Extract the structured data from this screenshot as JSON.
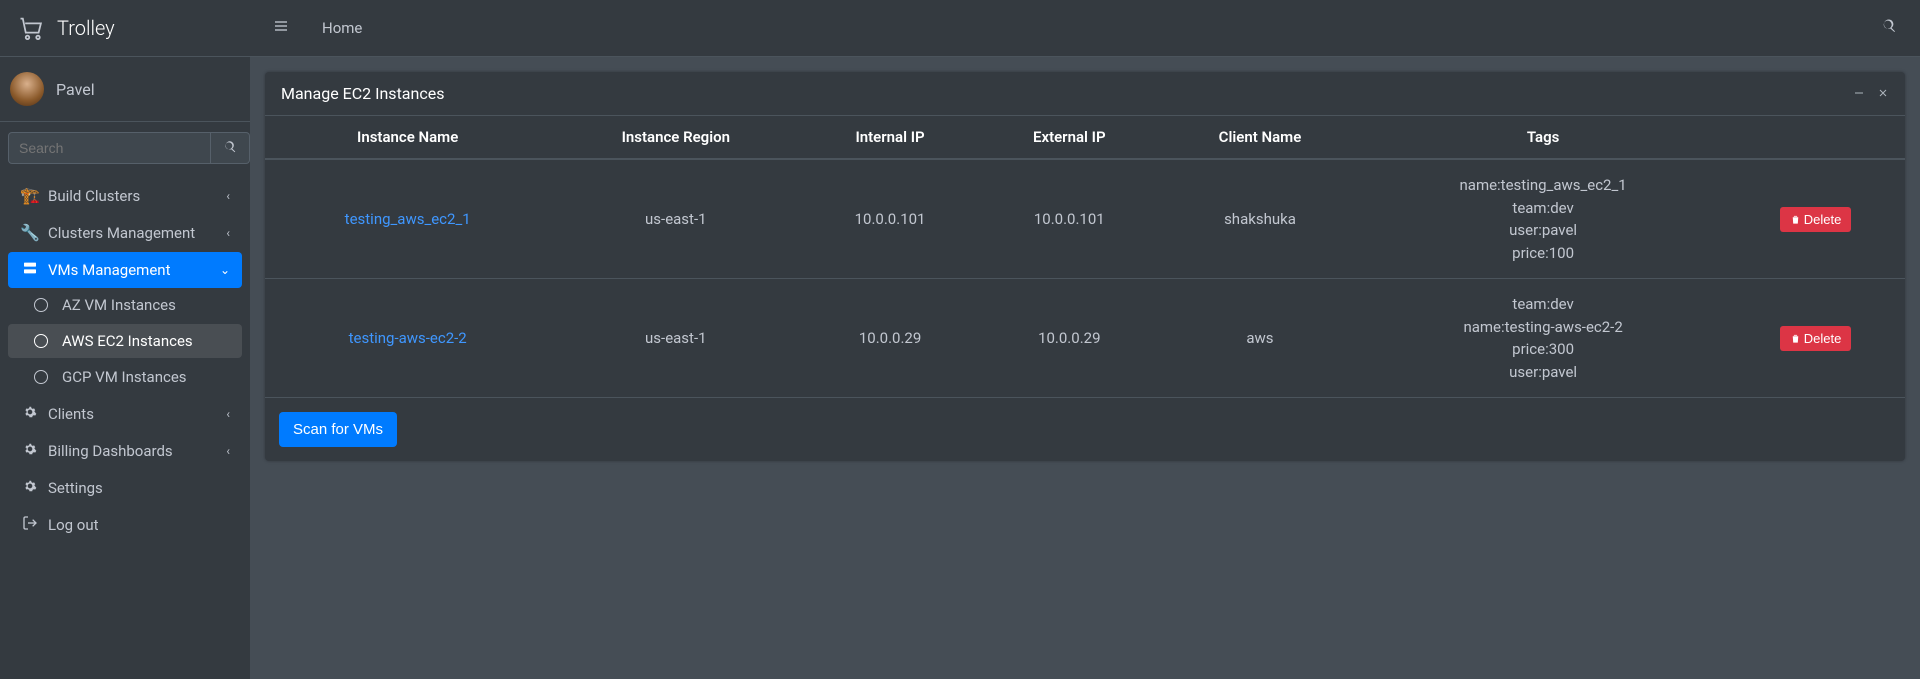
{
  "brand": {
    "text": "Trolley"
  },
  "user": {
    "name": "Pavel"
  },
  "search": {
    "placeholder": "Search"
  },
  "nav": {
    "build_clusters": "Build Clusters",
    "clusters_mgmt": "Clusters Management",
    "vms_mgmt": "VMs Management",
    "az_vm": "AZ VM Instances",
    "aws_ec2": "AWS EC2 Instances",
    "gcp_vm": "GCP VM Instances",
    "clients": "Clients",
    "billing": "Billing Dashboards",
    "settings": "Settings",
    "logout": "Log out"
  },
  "topbar": {
    "home": "Home"
  },
  "card": {
    "title": "Manage EC2 Instances"
  },
  "table": {
    "headers": {
      "instance_name": "Instance Name",
      "instance_region": "Instance Region",
      "internal_ip": "Internal IP",
      "external_ip": "External IP",
      "client_name": "Client Name",
      "tags": "Tags"
    },
    "rows": [
      {
        "name": "testing_aws_ec2_1",
        "region": "us-east-1",
        "internal_ip": "10.0.0.101",
        "external_ip": "10.0.0.101",
        "client": "shakshuka",
        "tags": "name:testing_aws_ec2_1\nteam:dev\nuser:pavel\nprice:100"
      },
      {
        "name": "testing-aws-ec2-2",
        "region": "us-east-1",
        "internal_ip": "10.0.0.29",
        "external_ip": "10.0.0.29",
        "client": "aws",
        "tags": "team:dev\nname:testing-aws-ec2-2\nprice:300\nuser:pavel"
      }
    ]
  },
  "actions": {
    "delete": "Delete",
    "scan": "Scan for VMs"
  }
}
